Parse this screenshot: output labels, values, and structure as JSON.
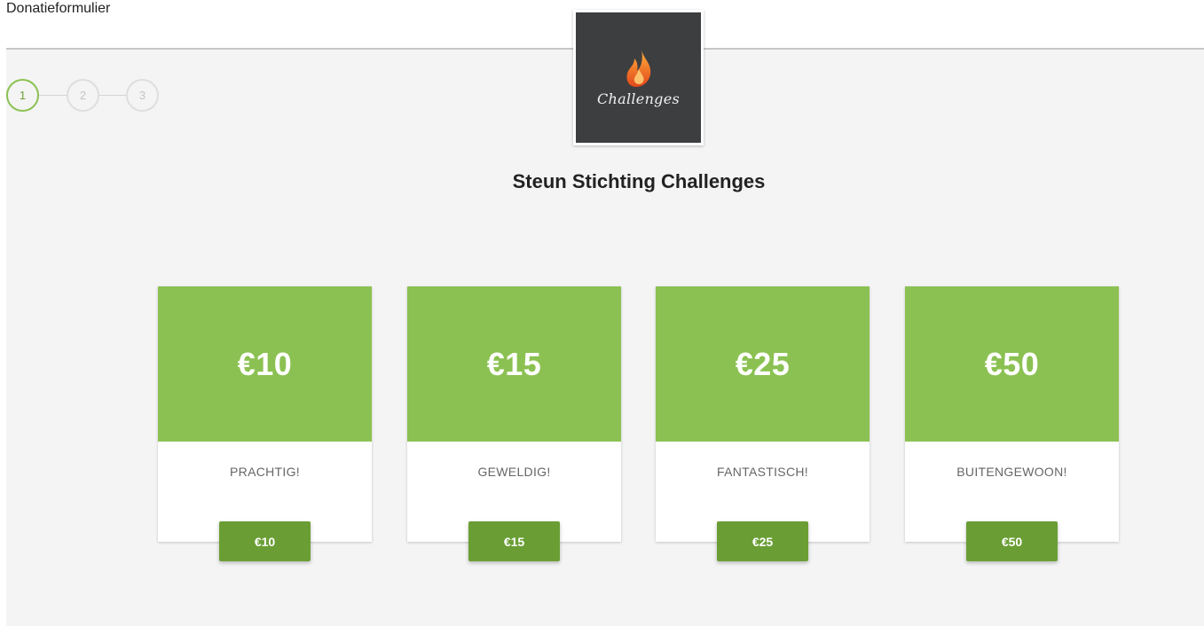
{
  "page": {
    "title": "Donatieformulier"
  },
  "stepper": {
    "steps": [
      "1",
      "2",
      "3"
    ],
    "active": 1
  },
  "logo": {
    "text": "Challenges",
    "icon": "flame-icon"
  },
  "heading": "Steun Stichting Challenges",
  "colors": {
    "accent": "#8bc152",
    "button": "#6a9e34"
  },
  "cards": [
    {
      "amount": "€10",
      "label": "PRACHTIG!",
      "button": "€10"
    },
    {
      "amount": "€15",
      "label": "GEWELDIG!",
      "button": "€15"
    },
    {
      "amount": "€25",
      "label": "FANTASTISCH!",
      "button": "€25"
    },
    {
      "amount": "€50",
      "label": "BUITENGEWOON!",
      "button": "€50"
    }
  ]
}
